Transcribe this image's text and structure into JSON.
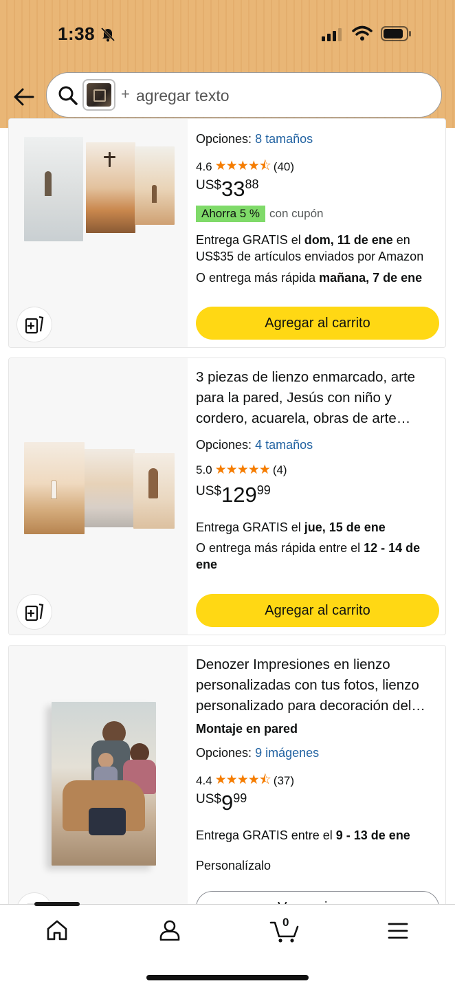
{
  "status_bar": {
    "time": "1:38"
  },
  "search": {
    "placeholder": "agregar texto",
    "plus": "+"
  },
  "products": [
    {
      "options_label": "Opciones:",
      "options_value": "8 tamaños",
      "rating": "4.6",
      "stars": "★★★★⯪",
      "reviews": "(40)",
      "price_currency": "US$",
      "price_whole": "33",
      "price_cents": "88",
      "badge": "Ahorra 5 %",
      "coupon": "con cupón",
      "delivery1_a": "Entrega GRATIS el ",
      "delivery1_b": "dom, 11 de ene",
      "delivery1_c": " en",
      "delivery2": "US$35 de artículos enviados por Amazon",
      "faster_a": "O entrega más rápida ",
      "faster_b": "mañana, 7 de ene",
      "button": "Agregar al carrito"
    },
    {
      "title": "3 piezas de lienzo enmarcado, arte para la pared, Jesús con niño y cordero, acuarela, obras de arte…",
      "options_label": "Opciones:",
      "options_value": "4 tamaños",
      "rating": "5.0",
      "stars": "★★★★★",
      "reviews": "(4)",
      "price_currency": "US$",
      "price_whole": "129",
      "price_cents": "99",
      "delivery1_a": "Entrega GRATIS el ",
      "delivery1_b": "jue, 15 de ene",
      "faster_a": "O entrega más rápida entre el ",
      "faster_b": "12 - 14 de",
      "faster_c": "ene",
      "button": "Agregar al carrito"
    },
    {
      "title": "Denozer Impresiones en lienzo personalizadas con tus fotos, lienzo personalizado para decoración del…",
      "feature": "Montaje en pared",
      "options_label": "Opciones:",
      "options_value": "9 imágenes",
      "rating": "4.4",
      "stars": "★★★★⯪",
      "reviews": "(37)",
      "price_currency": "US$",
      "price_whole": "9",
      "price_cents": "99",
      "delivery1_a": "Entrega GRATIS entre el ",
      "delivery1_b": "9 - 13 de ene",
      "personalize": "Personalízalo",
      "button": "Ver opciones"
    }
  ],
  "bottom_nav": {
    "cart_count": "0",
    "items": [
      "home-icon",
      "account-icon",
      "cart-icon",
      "menu-icon"
    ]
  },
  "colors": {
    "header": "#e9b676",
    "cart_button": "#ffd814",
    "badge": "#7fda69",
    "link": "#2162a1",
    "stars": "#f57c00"
  }
}
